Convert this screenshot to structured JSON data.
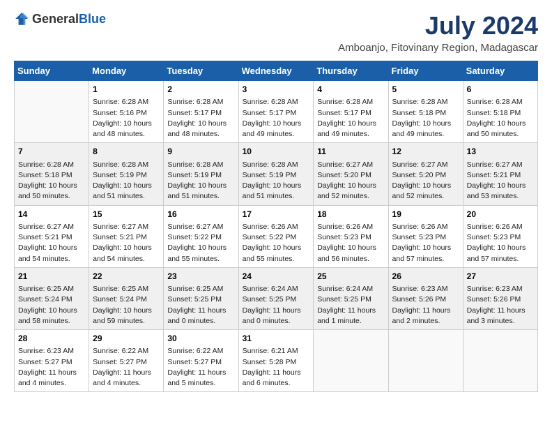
{
  "logo": {
    "general": "General",
    "blue": "Blue"
  },
  "header": {
    "title": "July 2024",
    "subtitle": "Amboanjo, Fitovinany Region, Madagascar"
  },
  "weekdays": [
    "Sunday",
    "Monday",
    "Tuesday",
    "Wednesday",
    "Thursday",
    "Friday",
    "Saturday"
  ],
  "weeks": [
    [
      {
        "day": "",
        "info": ""
      },
      {
        "day": "1",
        "info": "Sunrise: 6:28 AM\nSunset: 5:16 PM\nDaylight: 10 hours\nand 48 minutes."
      },
      {
        "day": "2",
        "info": "Sunrise: 6:28 AM\nSunset: 5:17 PM\nDaylight: 10 hours\nand 48 minutes."
      },
      {
        "day": "3",
        "info": "Sunrise: 6:28 AM\nSunset: 5:17 PM\nDaylight: 10 hours\nand 49 minutes."
      },
      {
        "day": "4",
        "info": "Sunrise: 6:28 AM\nSunset: 5:17 PM\nDaylight: 10 hours\nand 49 minutes."
      },
      {
        "day": "5",
        "info": "Sunrise: 6:28 AM\nSunset: 5:18 PM\nDaylight: 10 hours\nand 49 minutes."
      },
      {
        "day": "6",
        "info": "Sunrise: 6:28 AM\nSunset: 5:18 PM\nDaylight: 10 hours\nand 50 minutes."
      }
    ],
    [
      {
        "day": "7",
        "info": "Sunrise: 6:28 AM\nSunset: 5:18 PM\nDaylight: 10 hours\nand 50 minutes."
      },
      {
        "day": "8",
        "info": "Sunrise: 6:28 AM\nSunset: 5:19 PM\nDaylight: 10 hours\nand 51 minutes."
      },
      {
        "day": "9",
        "info": "Sunrise: 6:28 AM\nSunset: 5:19 PM\nDaylight: 10 hours\nand 51 minutes."
      },
      {
        "day": "10",
        "info": "Sunrise: 6:28 AM\nSunset: 5:19 PM\nDaylight: 10 hours\nand 51 minutes."
      },
      {
        "day": "11",
        "info": "Sunrise: 6:27 AM\nSunset: 5:20 PM\nDaylight: 10 hours\nand 52 minutes."
      },
      {
        "day": "12",
        "info": "Sunrise: 6:27 AM\nSunset: 5:20 PM\nDaylight: 10 hours\nand 52 minutes."
      },
      {
        "day": "13",
        "info": "Sunrise: 6:27 AM\nSunset: 5:21 PM\nDaylight: 10 hours\nand 53 minutes."
      }
    ],
    [
      {
        "day": "14",
        "info": "Sunrise: 6:27 AM\nSunset: 5:21 PM\nDaylight: 10 hours\nand 54 minutes."
      },
      {
        "day": "15",
        "info": "Sunrise: 6:27 AM\nSunset: 5:21 PM\nDaylight: 10 hours\nand 54 minutes."
      },
      {
        "day": "16",
        "info": "Sunrise: 6:27 AM\nSunset: 5:22 PM\nDaylight: 10 hours\nand 55 minutes."
      },
      {
        "day": "17",
        "info": "Sunrise: 6:26 AM\nSunset: 5:22 PM\nDaylight: 10 hours\nand 55 minutes."
      },
      {
        "day": "18",
        "info": "Sunrise: 6:26 AM\nSunset: 5:23 PM\nDaylight: 10 hours\nand 56 minutes."
      },
      {
        "day": "19",
        "info": "Sunrise: 6:26 AM\nSunset: 5:23 PM\nDaylight: 10 hours\nand 57 minutes."
      },
      {
        "day": "20",
        "info": "Sunrise: 6:26 AM\nSunset: 5:23 PM\nDaylight: 10 hours\nand 57 minutes."
      }
    ],
    [
      {
        "day": "21",
        "info": "Sunrise: 6:25 AM\nSunset: 5:24 PM\nDaylight: 10 hours\nand 58 minutes."
      },
      {
        "day": "22",
        "info": "Sunrise: 6:25 AM\nSunset: 5:24 PM\nDaylight: 10 hours\nand 59 minutes."
      },
      {
        "day": "23",
        "info": "Sunrise: 6:25 AM\nSunset: 5:25 PM\nDaylight: 11 hours\nand 0 minutes."
      },
      {
        "day": "24",
        "info": "Sunrise: 6:24 AM\nSunset: 5:25 PM\nDaylight: 11 hours\nand 0 minutes."
      },
      {
        "day": "25",
        "info": "Sunrise: 6:24 AM\nSunset: 5:25 PM\nDaylight: 11 hours\nand 1 minute."
      },
      {
        "day": "26",
        "info": "Sunrise: 6:23 AM\nSunset: 5:26 PM\nDaylight: 11 hours\nand 2 minutes."
      },
      {
        "day": "27",
        "info": "Sunrise: 6:23 AM\nSunset: 5:26 PM\nDaylight: 11 hours\nand 3 minutes."
      }
    ],
    [
      {
        "day": "28",
        "info": "Sunrise: 6:23 AM\nSunset: 5:27 PM\nDaylight: 11 hours\nand 4 minutes."
      },
      {
        "day": "29",
        "info": "Sunrise: 6:22 AM\nSunset: 5:27 PM\nDaylight: 11 hours\nand 4 minutes."
      },
      {
        "day": "30",
        "info": "Sunrise: 6:22 AM\nSunset: 5:27 PM\nDaylight: 11 hours\nand 5 minutes."
      },
      {
        "day": "31",
        "info": "Sunrise: 6:21 AM\nSunset: 5:28 PM\nDaylight: 11 hours\nand 6 minutes."
      },
      {
        "day": "",
        "info": ""
      },
      {
        "day": "",
        "info": ""
      },
      {
        "day": "",
        "info": ""
      }
    ]
  ]
}
